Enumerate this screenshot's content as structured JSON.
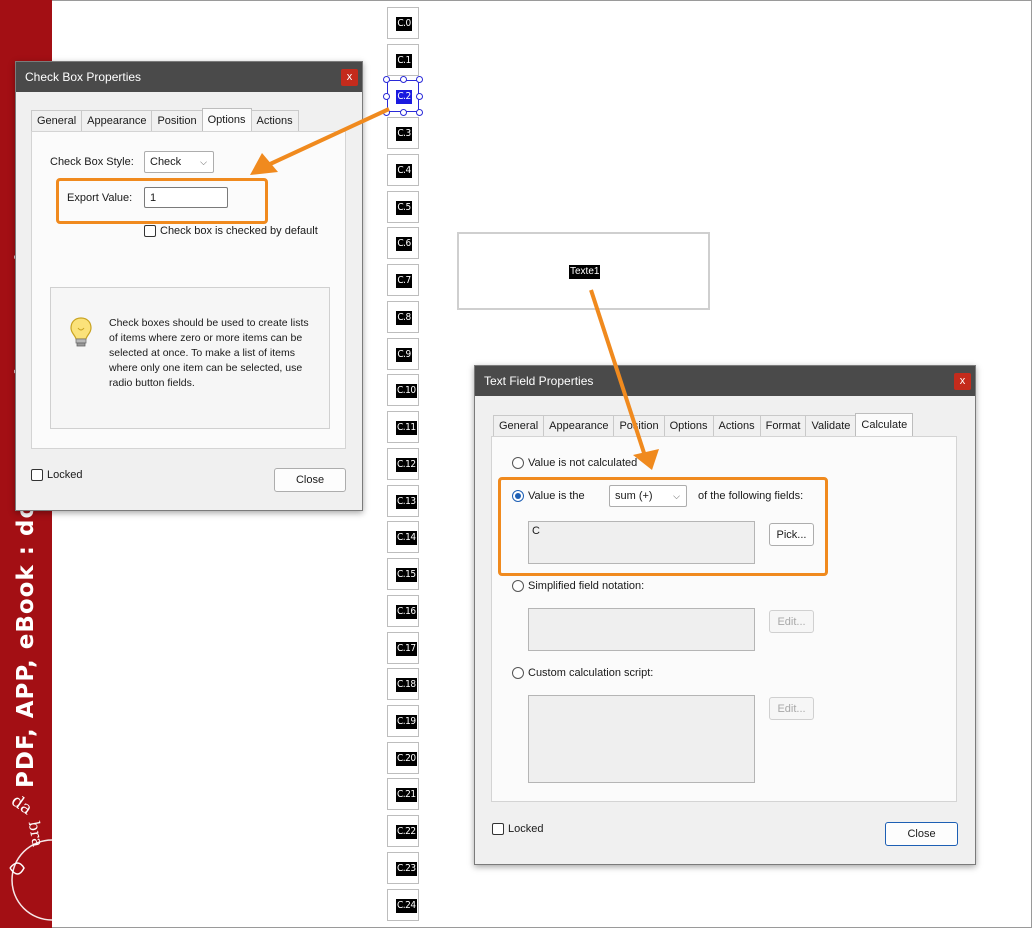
{
  "brand": {
    "band_text": "PDF, APP, eBook : donnez vie à vos idées !",
    "logo_text": "abracadabraPDF",
    "color": "#a30f14"
  },
  "checkbox_fields": [
    "C.0",
    "C.1",
    "C.2",
    "C.3",
    "C.4",
    "C.5",
    "C.6",
    "C.7",
    "C.8",
    "C.9",
    "C.10",
    "C.11",
    "C.12",
    "C.13",
    "C.14",
    "C.15",
    "C.16",
    "C.17",
    "C.18",
    "C.19",
    "C.20",
    "C.21",
    "C.22",
    "C.23",
    "C.24"
  ],
  "selected_field": "C.2",
  "text_field_label": "Texte1",
  "checkbox_dialog": {
    "title": "Check Box Properties",
    "close_x": "x",
    "tabs": [
      "General",
      "Appearance",
      "Position",
      "Options",
      "Actions"
    ],
    "active_tab": "Options",
    "style_label": "Check Box Style:",
    "style_value": "Check",
    "export_label": "Export Value:",
    "export_value": "1",
    "default_checked_label": "Check box is checked by default",
    "info_text": "Check boxes should be used to create lists of items where zero or more items can be selected at once. To make a list of items where only one item can be selected, use radio button fields.",
    "locked_label": "Locked",
    "close_button": "Close"
  },
  "textfield_dialog": {
    "title": "Text Field Properties",
    "close_x": "x",
    "tabs": [
      "General",
      "Appearance",
      "Position",
      "Options",
      "Actions",
      "Format",
      "Validate",
      "Calculate"
    ],
    "active_tab": "Calculate",
    "not_calculated": "Value is not calculated",
    "value_is_the": "Value is the",
    "operation": "sum (+)",
    "of_following": "of the following fields:",
    "fields_value": "C",
    "pick_button": "Pick...",
    "simplified_label": "Simplified field notation:",
    "edit_button_1": "Edit...",
    "custom_label": "Custom calculation script:",
    "edit_button_2": "Edit...",
    "locked_label": "Locked",
    "close_button": "Close"
  },
  "colors": {
    "highlight": "#f08a1e",
    "title_bar": "#4a4a4a",
    "close_red": "#c42b1c",
    "selection_blue": "#2a2ad8"
  }
}
